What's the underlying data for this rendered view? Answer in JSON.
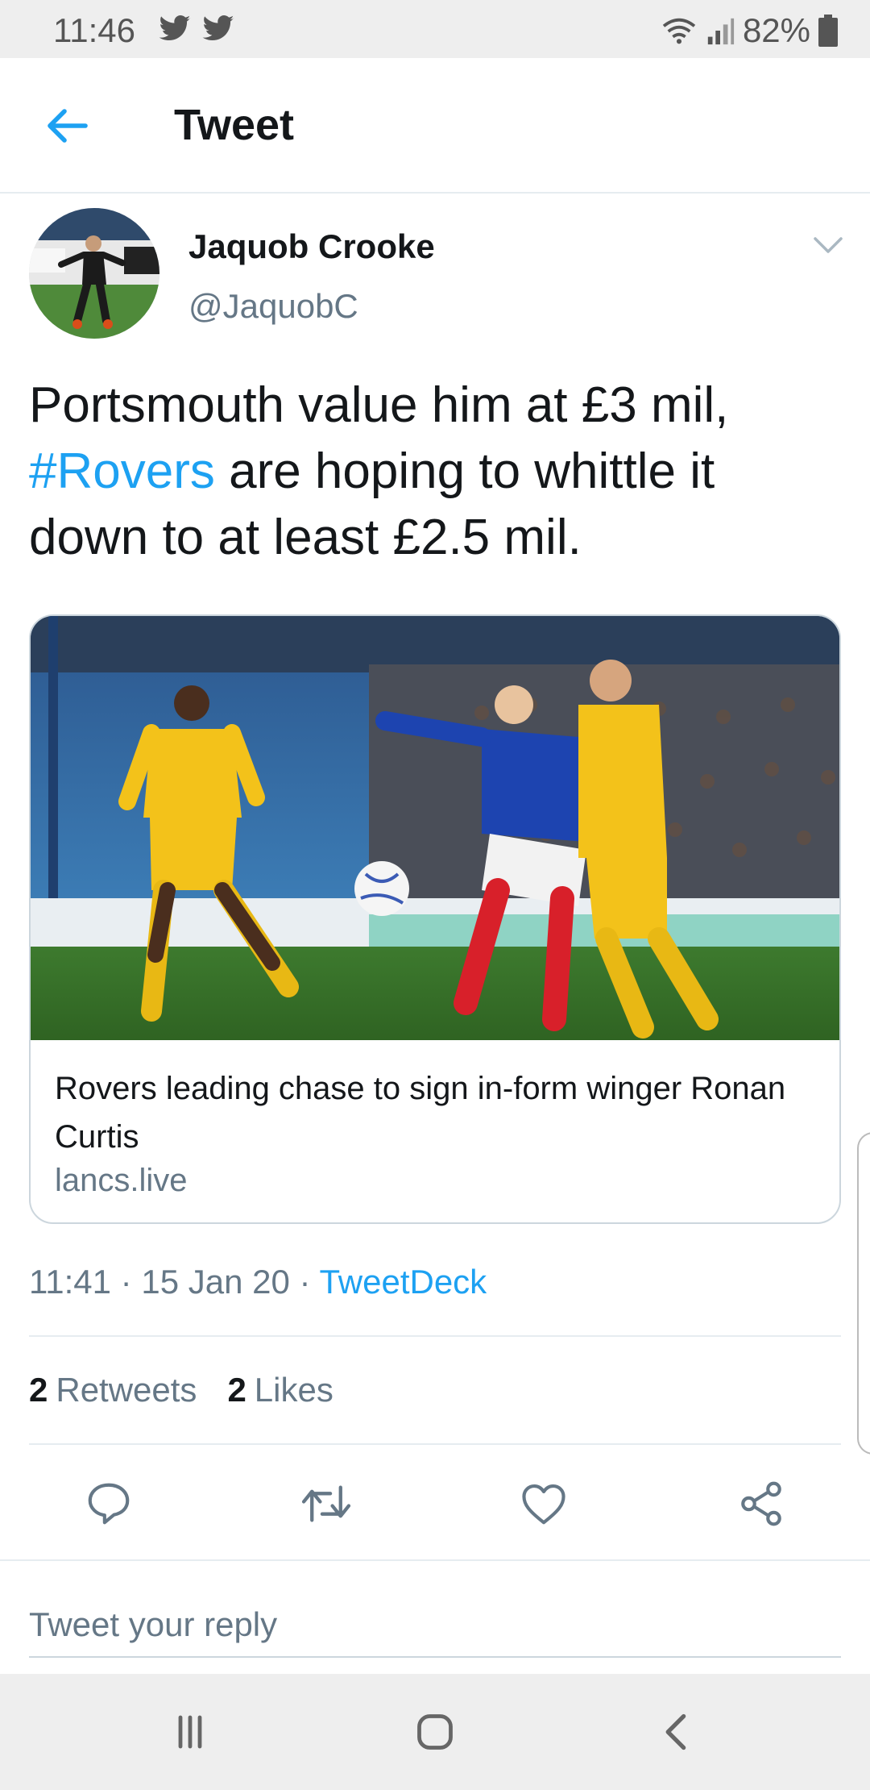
{
  "status_bar": {
    "time": "11:46",
    "battery": "82%"
  },
  "header": {
    "title": "Tweet"
  },
  "author": {
    "name": "Jaquob Crooke",
    "handle": "@JaquobC"
  },
  "tweet": {
    "text_part1": "Portsmouth value him at £3 mil, ",
    "hashtag": "#Rovers",
    "text_part2": " are hoping to whittle it down to at least £2.5 mil."
  },
  "card": {
    "title": "Rovers leading chase to sign in-form winger Ronan Curtis",
    "domain": "lancs.live"
  },
  "meta": {
    "time": "11:41",
    "separator": "·",
    "date": "15 Jan 20",
    "via": "TweetDeck"
  },
  "stats": {
    "retweets_count": "2",
    "retweets_label": "Retweets",
    "likes_count": "2",
    "likes_label": "Likes"
  },
  "actions": {
    "icons": [
      "reply-icon",
      "retweet-icon",
      "like-icon",
      "share-icon"
    ]
  },
  "reply": {
    "placeholder": "Tweet your reply"
  },
  "colors": {
    "accent": "#1da1f2",
    "text": "#14171a",
    "secondary": "#657786"
  }
}
